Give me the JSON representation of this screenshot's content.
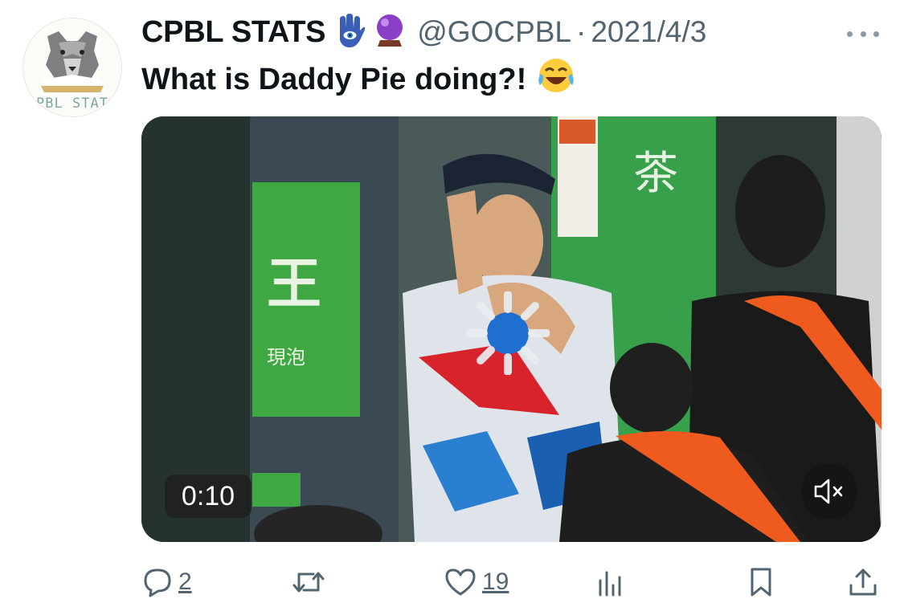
{
  "author": {
    "name": "CPBL STATS",
    "emojis": [
      "hamsa-emoji",
      "crystal-ball-emoji"
    ],
    "handle": "@GOCPBL",
    "separator": "·",
    "date": "2021/4/3",
    "avatar_text": "PBL STAT"
  },
  "tweet": {
    "text": "What is Daddy Pie doing?!",
    "emoji": "face-with-tears-of-joy-emoji"
  },
  "video": {
    "timestamp": "0:10",
    "sign_left_char": "王",
    "sign_left_sub": "現泡",
    "sign_right_chars": "茶",
    "muted": true,
    "icons": [
      "loading-spinner-icon",
      "volume-muted-icon"
    ]
  },
  "actions": {
    "reply_count": "2",
    "like_count": "19",
    "icons": [
      "reply-icon",
      "retweet-icon",
      "like-icon",
      "views-icon",
      "bookmark-icon",
      "share-icon"
    ]
  },
  "colors": {
    "text": "#0f1419",
    "secondary": "#536471",
    "sign_green": "#3fa843",
    "orange": "#ef5a1e"
  }
}
